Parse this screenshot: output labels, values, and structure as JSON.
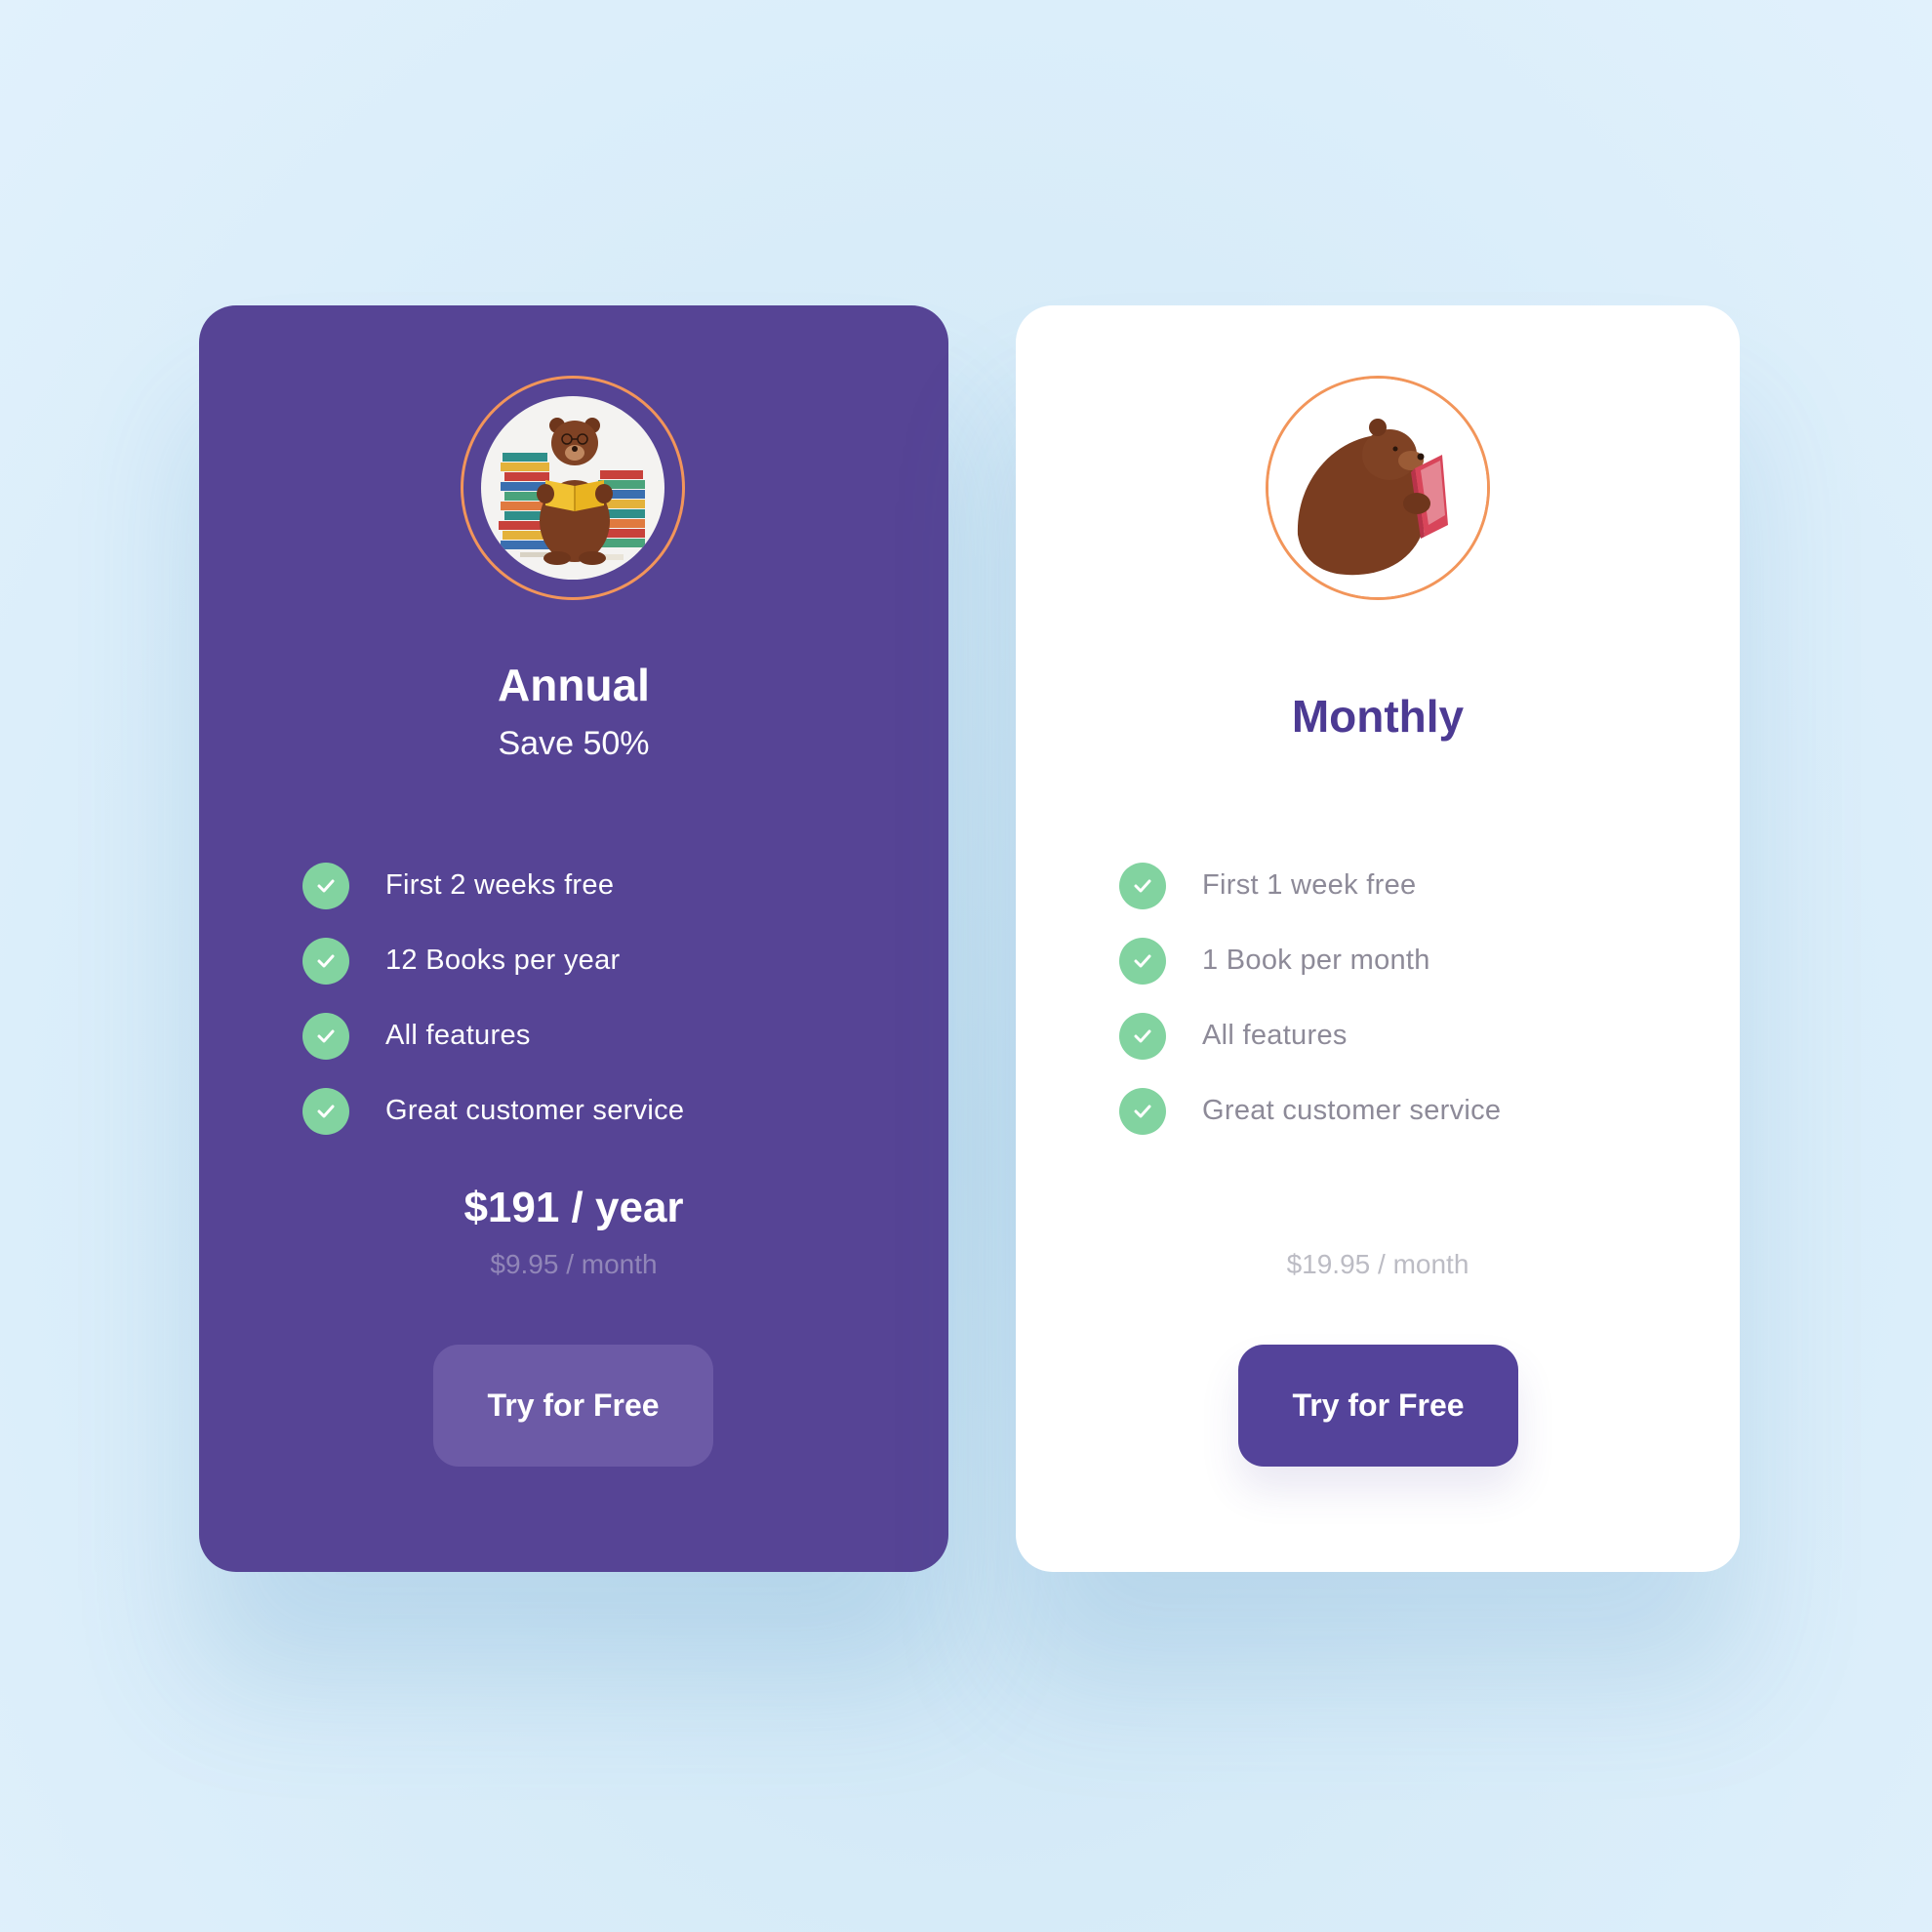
{
  "colors": {
    "annual_card_bg": "#564495",
    "monthly_card_bg": "#ffffff",
    "accent_purple": "#54439a",
    "check_green": "#82d3a0",
    "ring_orange": "#f2955a"
  },
  "plans": [
    {
      "avatar_icon": "bear-reading-with-book-stacks-illustration",
      "title": "Annual",
      "subtitle": "Save 50%",
      "features": [
        "First 2 weeks free",
        "12 Books per year",
        "All features",
        "Great customer service"
      ],
      "price": "$191 / year",
      "subprice": "$9.95 / month",
      "cta_label": "Try for Free"
    },
    {
      "avatar_icon": "bear-reading-book-illustration",
      "title": "Monthly",
      "features": [
        "First 1 week free",
        "1 Book per month",
        "All features",
        "Great customer service"
      ],
      "subprice": "$19.95 / month",
      "cta_label": "Try for Free"
    }
  ]
}
